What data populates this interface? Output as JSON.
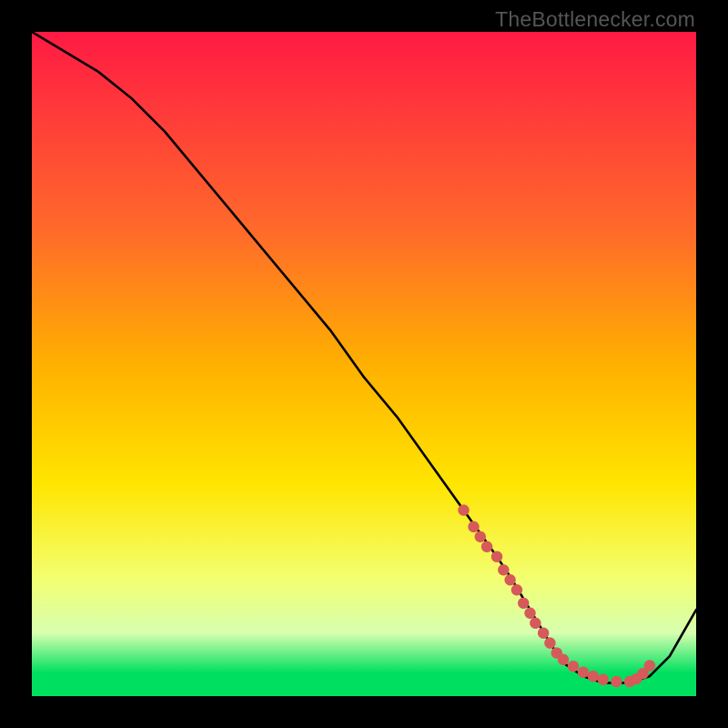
{
  "watermark": "TheBottlenecker.com",
  "colors": {
    "top": "#ff1a44",
    "mid1": "#ff6a2a",
    "mid2": "#ffb000",
    "mid3": "#ffe500",
    "mid4": "#f3ff6e",
    "band": "#d7ffb0",
    "green": "#00e060",
    "curve": "#000000",
    "dot": "#d65a5a",
    "bg": "#000000"
  },
  "chart_data": {
    "type": "line",
    "title": "",
    "xlabel": "",
    "ylabel": "",
    "xlim": [
      0,
      100
    ],
    "ylim": [
      0,
      100
    ],
    "series": [
      {
        "name": "curve",
        "x": [
          0,
          5,
          10,
          15,
          20,
          25,
          30,
          35,
          40,
          45,
          50,
          55,
          60,
          65,
          70,
          72,
          75,
          78,
          80,
          83,
          86,
          90,
          93,
          96,
          100
        ],
        "values": [
          100,
          97,
          94,
          90,
          85,
          79,
          73,
          67,
          61,
          55,
          48,
          42,
          35,
          28,
          21,
          18,
          13,
          8,
          5,
          3,
          2,
          2,
          3,
          6,
          13
        ]
      }
    ],
    "dots": {
      "x": [
        65,
        66.5,
        67.5,
        68.5,
        70,
        71,
        72,
        73,
        74,
        75,
        75.8,
        77,
        78,
        79,
        80,
        81.5,
        83,
        84.5,
        86,
        88,
        90,
        91,
        92,
        93
      ],
      "values": [
        28,
        25.5,
        24,
        22.5,
        21,
        19,
        17.5,
        16,
        14,
        12.5,
        11,
        9.5,
        8,
        6.5,
        5.5,
        4.5,
        3.6,
        3,
        2.5,
        2.2,
        2.2,
        2.6,
        3.4,
        4.6
      ]
    },
    "gradient_stops": [
      {
        "offset": 0.0,
        "color_key": "top"
      },
      {
        "offset": 0.3,
        "color_key": "mid1"
      },
      {
        "offset": 0.5,
        "color_key": "mid2"
      },
      {
        "offset": 0.68,
        "color_key": "mid3"
      },
      {
        "offset": 0.82,
        "color_key": "mid4"
      },
      {
        "offset": 0.905,
        "color_key": "band"
      },
      {
        "offset": 0.965,
        "color_key": "green"
      },
      {
        "offset": 1.0,
        "color_key": "green"
      }
    ]
  }
}
